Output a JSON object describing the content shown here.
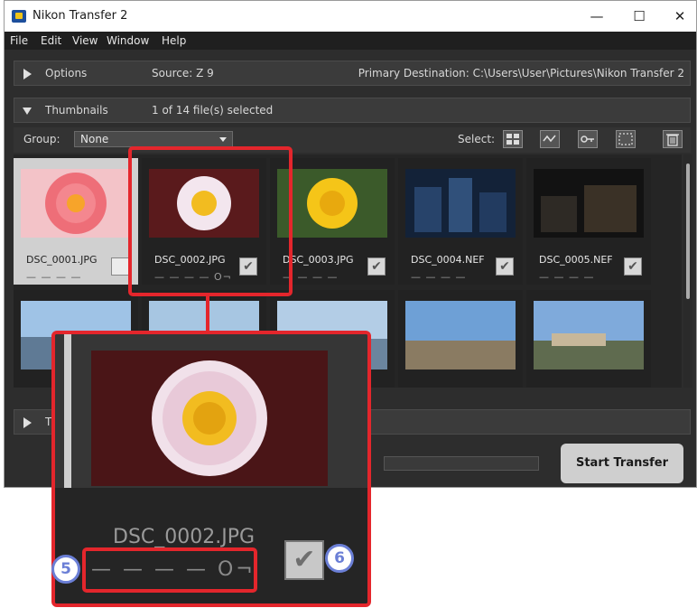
{
  "window": {
    "title": "Nikon Transfer 2"
  },
  "menu": [
    "File",
    "Edit",
    "View",
    "Window",
    "Help"
  ],
  "options_panel": {
    "label": "Options",
    "source": "Source: Z 9",
    "destination": "Primary Destination: C:\\Users\\User\\Pictures\\Nikon Transfer 2"
  },
  "thumbnails_panel": {
    "label": "Thumbnails",
    "selection_count": "1 of 14 file(s) selected"
  },
  "toolbar": {
    "group_label": "Group:",
    "group_value": "None",
    "select_label": "Select:"
  },
  "thumbnails": [
    {
      "name": "DSC_0001.JPG",
      "marks": "— — — —",
      "checked": false,
      "selected": true
    },
    {
      "name": "DSC_0002.JPG",
      "marks": "— — — — O¬",
      "checked": true,
      "selected": false
    },
    {
      "name": "DSC_0003.JPG",
      "marks": "— — — —",
      "checked": true,
      "selected": false
    },
    {
      "name": "DSC_0004.NEF",
      "marks": "— — — —",
      "checked": true,
      "selected": false
    },
    {
      "name": "DSC_0005.NEF",
      "marks": "— — — —",
      "checked": true,
      "selected": false
    }
  ],
  "transfer_panel": {
    "label": "T"
  },
  "start_transfer": "Start Transfer",
  "zoom": {
    "name": "DSC_0002.JPG",
    "marks": "— — — — O¬"
  },
  "callouts": [
    "5",
    "6"
  ],
  "colors": {
    "callout_red": "#e4262c",
    "badge_blue": "#6b7fd6"
  },
  "icons": [
    "select-all-icon",
    "select-modified-icon",
    "select-protected-icon",
    "deselect-icon",
    "trash-icon",
    "checkbox-check-icon",
    "protect-key-icon"
  ]
}
